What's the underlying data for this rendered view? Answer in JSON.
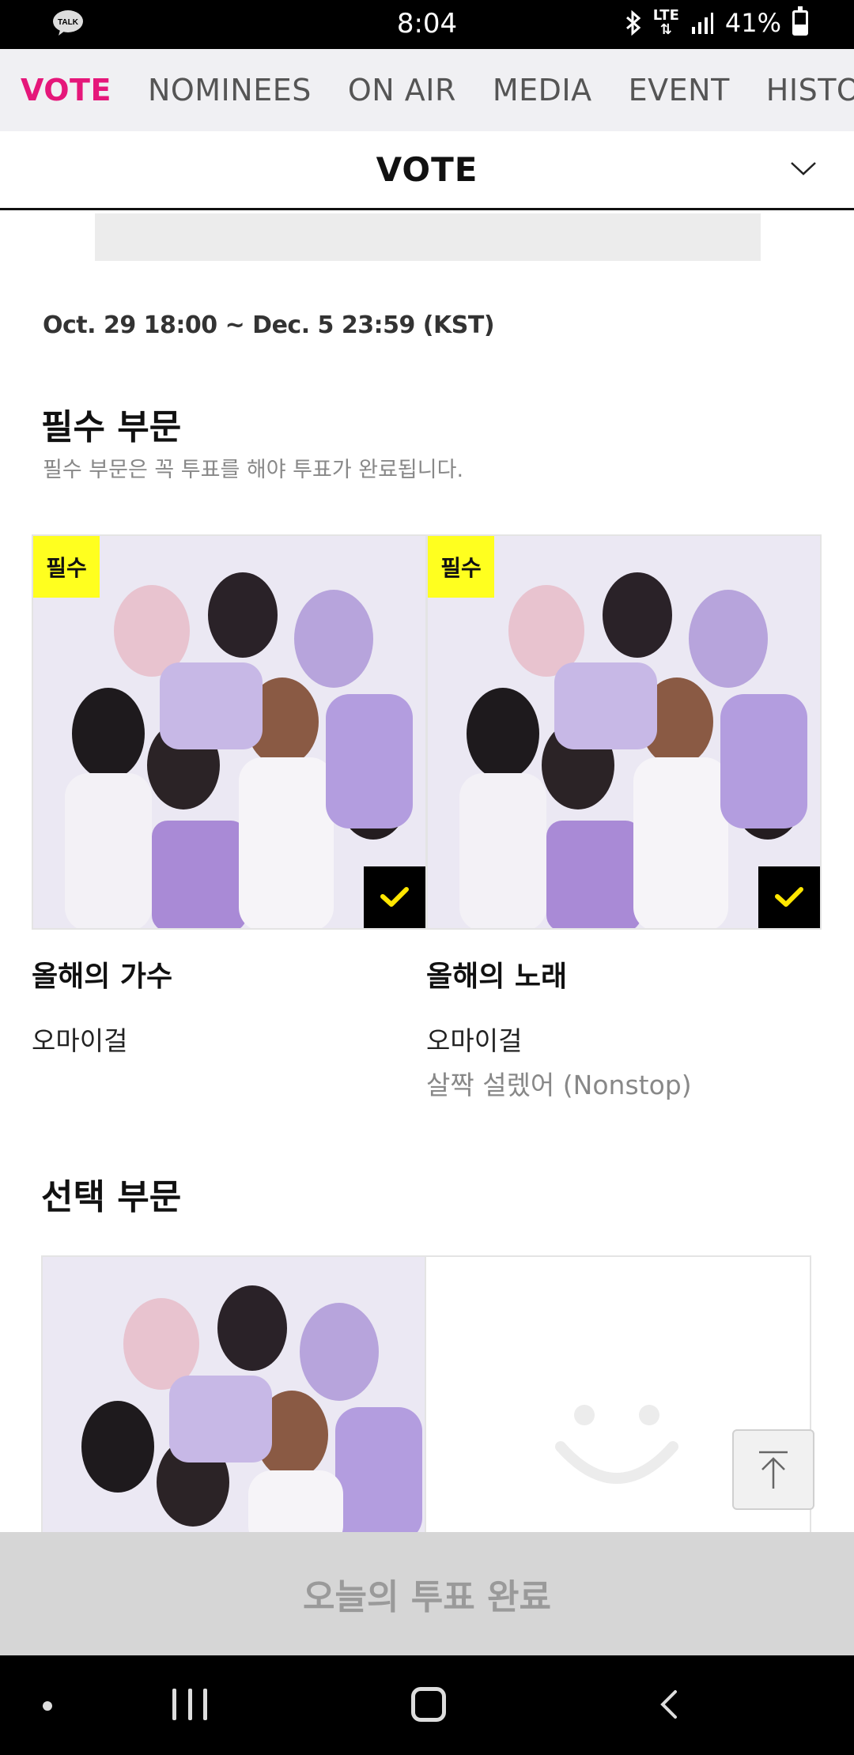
{
  "status_bar": {
    "time": "8:04",
    "app_icon_label": "TALK",
    "network": "LTE",
    "battery": "41%",
    "battery_level": 0.41
  },
  "tabs": [
    "VOTE",
    "NOMINEES",
    "ON AIR",
    "MEDIA",
    "EVENT",
    "HISTORY"
  ],
  "active_tab": "VOTE",
  "section_header": {
    "title": "VOTE"
  },
  "vote_period": "Oct. 29 18:00 ~ Dec. 5 23:59 (KST)",
  "required_section": {
    "title": "필수 부문",
    "description": "필수 부문은 꼭 투표를 해야 투표가 완료됩니다.",
    "cards": [
      {
        "badge": "필수",
        "category": "올해의 가수",
        "artist": "오마이걸",
        "song": "",
        "selected": true
      },
      {
        "badge": "필수",
        "category": "올해의 노래",
        "artist": "오마이걸",
        "song": "살짝 설렜어 (Nonstop)",
        "selected": true
      }
    ]
  },
  "optional_section": {
    "title": "선택 부문"
  },
  "bottom_button": "오늘의 투표 완료",
  "colors": {
    "accent_pink": "#e5177a",
    "badge_yellow": "#ffff1f",
    "check_yellow": "#ffe600"
  }
}
